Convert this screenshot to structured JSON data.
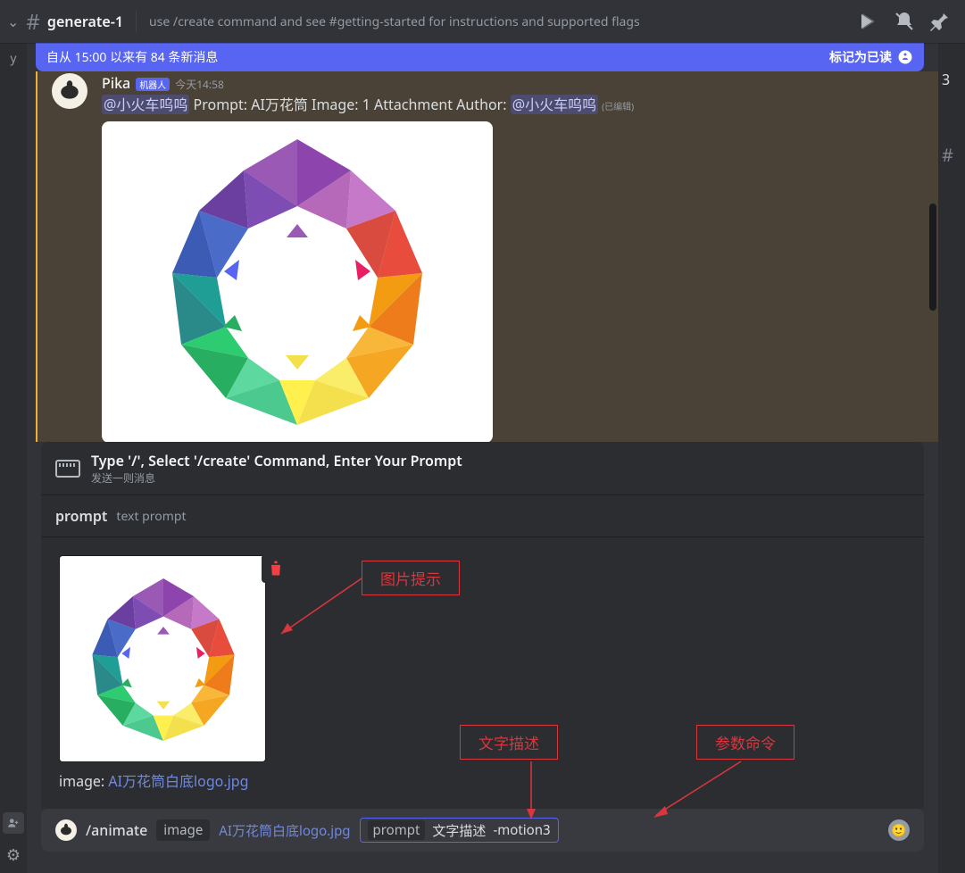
{
  "header": {
    "channel_name": "generate-1",
    "topic": "use /create command and see #getting-started for instructions and supported flags"
  },
  "new_messages": {
    "text": "自从 15:00 以来有 84 条新消息",
    "mark": "标记为已读"
  },
  "rightpanel": {
    "label": "3",
    "hash": "#"
  },
  "leftpanel": {
    "cut": "y"
  },
  "message": {
    "author": "Pika",
    "bot_tag": "机器人",
    "timestamp": "今天14:58",
    "mention1": "@小火车呜呜",
    "prompt_label": " Prompt: ",
    "prompt_value": "AI万花筒",
    "image_label": "  Image: ",
    "image_value": "1 Attachment",
    "author_label": "  Author: ",
    "mention2": "@小火车呜呜",
    "edited": "(已编辑)"
  },
  "command_hint": {
    "title": "Type '/', Select '/create' Command, Enter Your Prompt",
    "subtitle": "发送一则消息"
  },
  "prompt_row": {
    "label": "prompt",
    "desc": "text prompt"
  },
  "upload": {
    "label": "image: ",
    "filename": "AI万花筒白底logo.jpg"
  },
  "input": {
    "command": "/animate",
    "chip_label": "image",
    "chip_value": "AI万花筒白底logo.jpg",
    "prompt_label": "prompt",
    "prompt_text": "文字描述",
    "prompt_param": "-motion3"
  },
  "annotations": {
    "a1": "图片提示",
    "a2": "文字描述",
    "a3": "参数命令"
  }
}
